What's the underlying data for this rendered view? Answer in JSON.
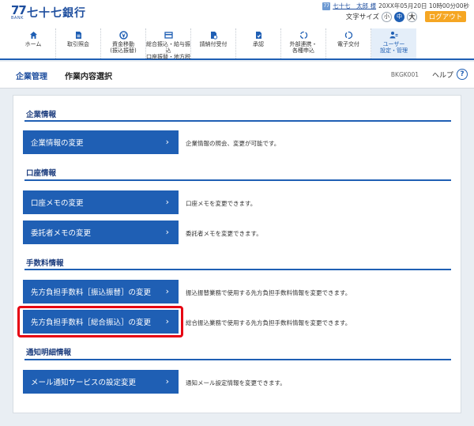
{
  "header": {
    "bank_mark": "77",
    "bank_mark_sub": "BANK",
    "bank_name": "七十七銀行",
    "user_icon": "77",
    "user_name": "七十七　太郎 様",
    "login_time": "20XX年05月20日 10時00分00秒",
    "text_size_label": "文字サイズ",
    "text_size_small": "小",
    "text_size_medium": "中",
    "text_size_large": "大",
    "text_size_selected": "中",
    "logout_label": "ログアウト"
  },
  "nav": {
    "items": [
      {
        "label": "ホーム",
        "icon": "home-icon"
      },
      {
        "label": "取引照会",
        "icon": "document-icon"
      },
      {
        "label": "資金移動\n(振込振替)",
        "icon": "transfer-icon"
      },
      {
        "label": "総合振込・給与振込\n口座振替・地方税",
        "icon": "card-icon"
      },
      {
        "label": "請納付受付",
        "icon": "payment-icon"
      },
      {
        "label": "承認",
        "icon": "approve-icon"
      },
      {
        "label": "外部連携・\n各種申込",
        "icon": "link-icon"
      },
      {
        "label": "電子交付",
        "icon": "refresh-icon"
      },
      {
        "label": "ユーザー\n設定・管理",
        "icon": "user-settings-icon"
      }
    ],
    "current_index": 8
  },
  "page": {
    "crumb_parent": "企業管理",
    "crumb_current": "作業内容選択",
    "screen_id": "BKGK001",
    "help_label": "ヘルプ",
    "help_icon": "?"
  },
  "sections": [
    {
      "title": "企業情報",
      "actions": [
        {
          "label": "企業情報の変更",
          "desc": "企業情報の照会、変更が可能です。"
        }
      ]
    },
    {
      "title": "口座情報",
      "actions": [
        {
          "label": "口座メモの変更",
          "desc": "口座メモを変更できます。"
        },
        {
          "label": "委託者メモの変更",
          "desc": "委託者メモを変更できます。"
        }
      ]
    },
    {
      "title": "手数料情報",
      "actions": [
        {
          "label": "先方負担手数料［振込振替］の変更",
          "desc": "振込振替業務で使用する先方負担手数料情報を変更できます。"
        },
        {
          "label": "先方負担手数料［総合振込］の変更",
          "desc": "総合振込業務で使用する先方負担手数料情報を変更できます。"
        }
      ]
    },
    {
      "title": "通知明細情報",
      "actions": [
        {
          "label": "メール通知サービスの設定変更",
          "desc": "通知メール設定情報を変更できます。"
        }
      ]
    }
  ],
  "chevron": "›",
  "colors": {
    "primary": "#1f5fb4",
    "logout": "#f5a623",
    "highlight": "#e60012"
  }
}
